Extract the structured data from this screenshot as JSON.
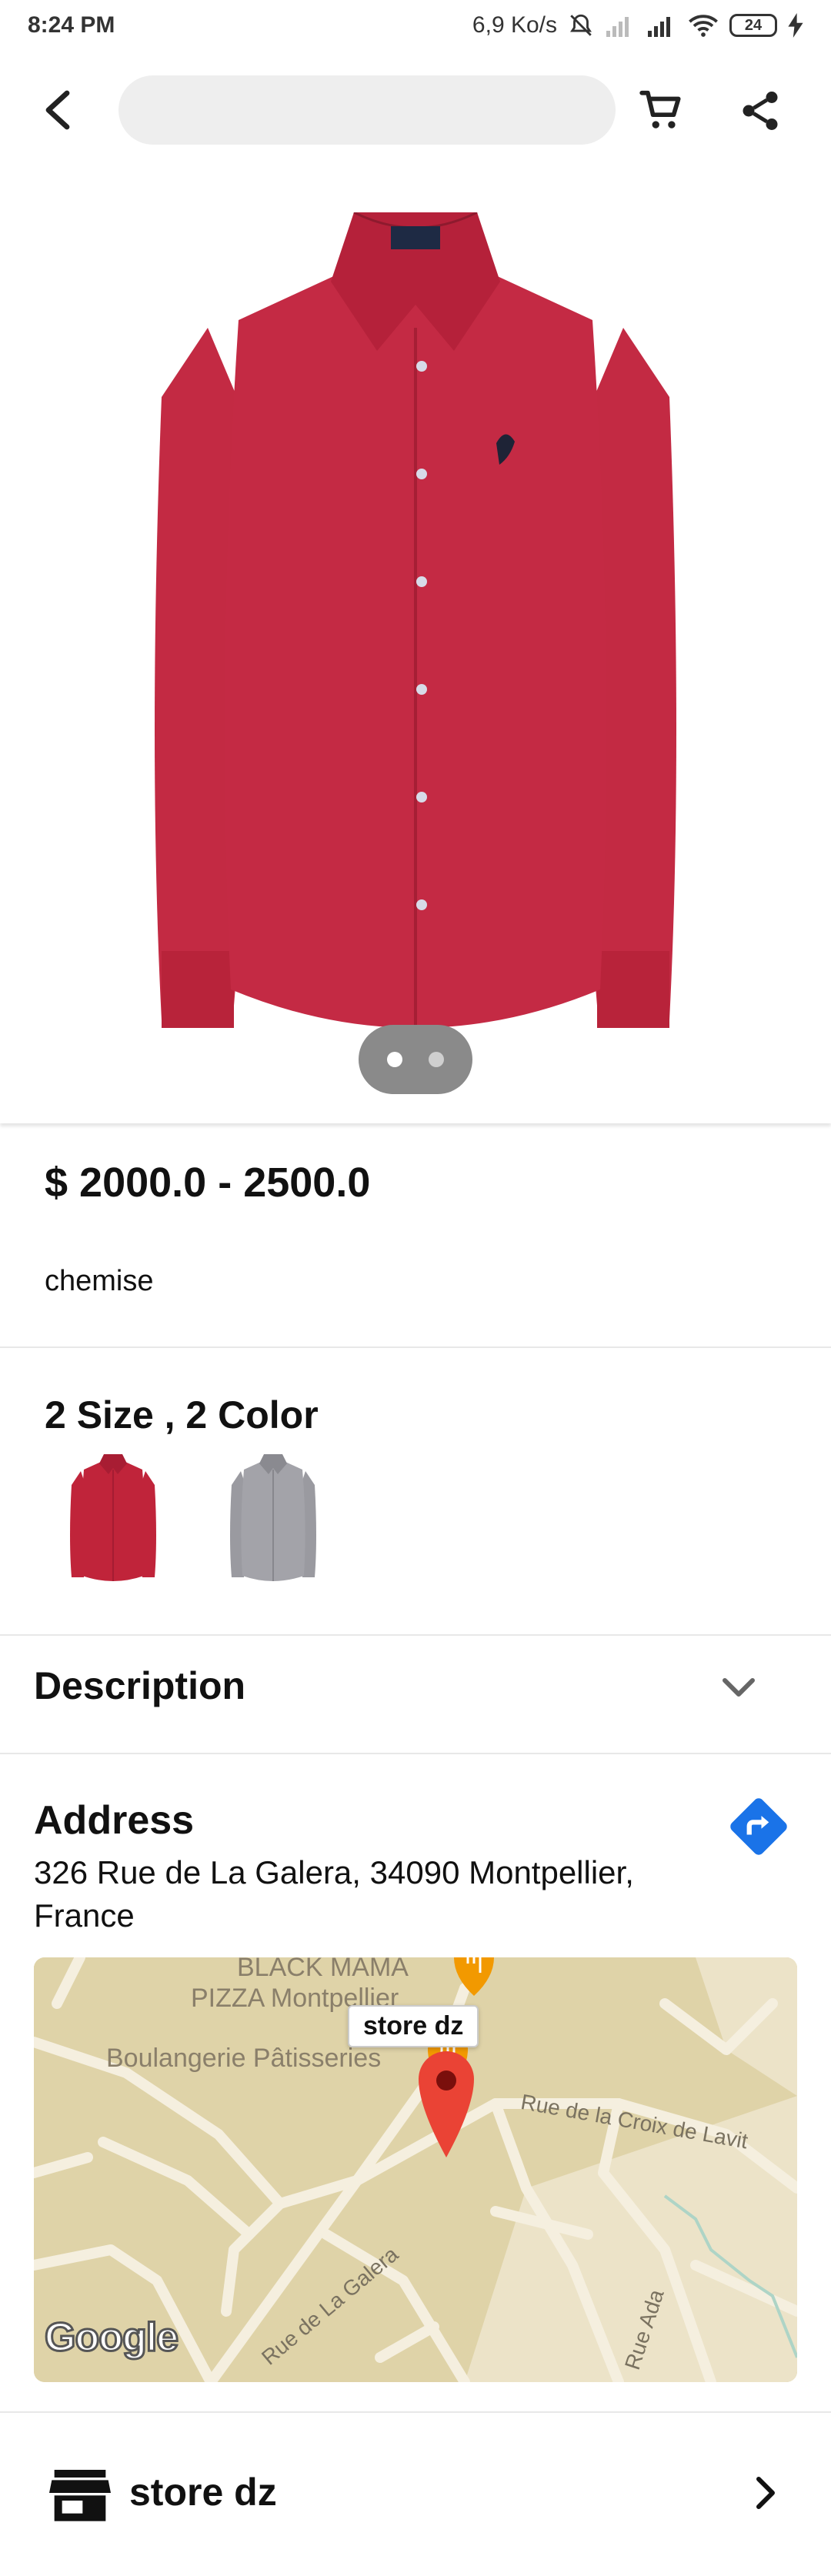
{
  "status_bar": {
    "time": "8:24 PM",
    "network_speed": "6,9 Ko/s",
    "battery": "24",
    "icons": [
      "mute-icon",
      "signal-icon",
      "signal-r-icon",
      "wifi-icon",
      "battery-icon",
      "charging-icon"
    ]
  },
  "top_bar": {
    "search_placeholder": "",
    "icons": [
      "back-arrow-icon",
      "cart-icon",
      "share-icon"
    ]
  },
  "carousel": {
    "image": "red-shirt",
    "image_count": 2,
    "active_index": 0
  },
  "product": {
    "price": "$ 2000.0 - 2500.0",
    "name": "chemise"
  },
  "variants": {
    "title": "2 Size , 2 Color",
    "colors": [
      {
        "name": "red",
        "hex": "#c0243a"
      },
      {
        "name": "grey",
        "hex": "#9a9aa0"
      }
    ]
  },
  "description": {
    "title": "Description"
  },
  "address": {
    "title": "Address",
    "text": "326 Rue de La Galera, 34090 Montpellier, France"
  },
  "map": {
    "marker_label": "store dz",
    "poi_1_line1": "BLACK MAMA",
    "poi_1_line2": "PIZZA Montpellier",
    "poi_2": "Boulangerie Pâtisseries",
    "street_1": "Rue de la Croix de Lavit",
    "street_2": "Rue de La Galera",
    "street_3": "Rue Ada",
    "attribution": "Google"
  },
  "store": {
    "name": "store dz"
  },
  "colors": {
    "accent_blue": "#1a73e8",
    "marker_red": "#ea4335",
    "poi_orange": "#f29900",
    "map_land": "#dfd3a8"
  }
}
